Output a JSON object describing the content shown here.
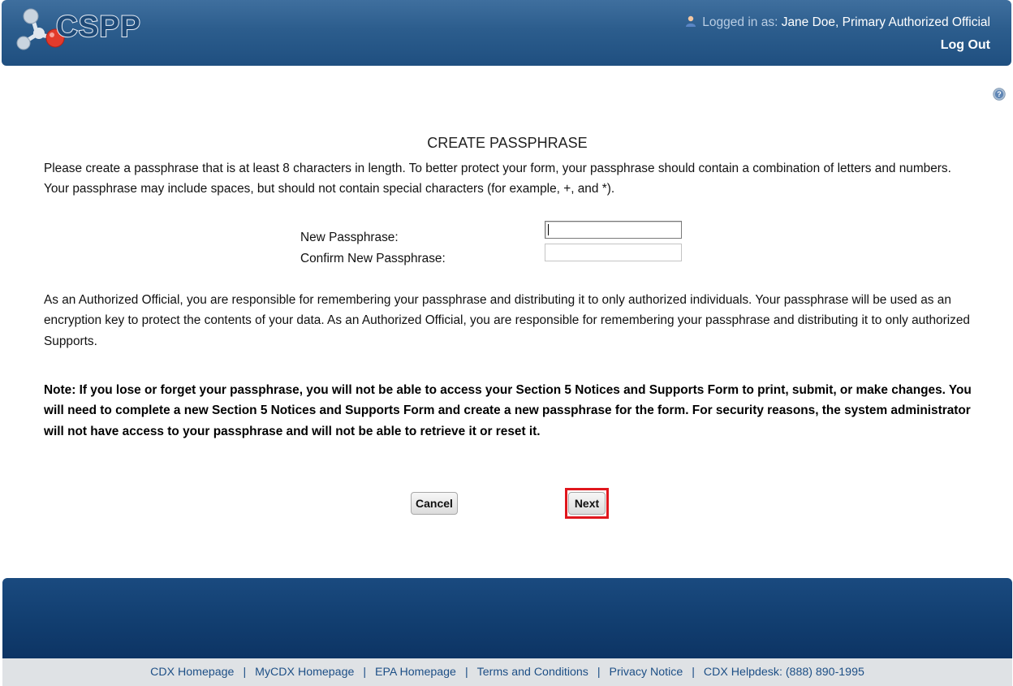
{
  "header": {
    "logo_text": "CSPP",
    "logged_in_prefix": "Logged in as:",
    "user_name": "Jane Doe, Primary Authorized Official",
    "logout_label": "Log Out"
  },
  "page": {
    "title": "CREATE PASSPHRASE",
    "intro": "Please create a passphrase that is at least 8 characters in length. To better protect your form, your passphrase should contain a combination of letters and numbers. Your passphrase may include spaces, but should not contain special characters (for example, +, and *).",
    "fields": {
      "new_label": "New Passphrase:",
      "new_value": "",
      "confirm_label": "Confirm New Passphrase:",
      "confirm_value": ""
    },
    "responsibility": "As an Authorized Official, you are responsible for remembering your passphrase and distributing it to only authorized individuals. Your passphrase will be used as an encryption key to protect the contents of your data. As an Authorized Official, you are responsible for remembering your passphrase and distributing it to only authorized Supports.",
    "note": "Note: If you lose or forget your passphrase, you will not be able to access your Section 5 Notices and Supports Form to print, submit, or make changes. You will need to complete a new Section 5 Notices and Supports Form and create a new passphrase for the form. For security reasons, the system administrator will not have access to your passphrase and will not be able to retrieve it or reset it.",
    "buttons": {
      "cancel": "Cancel",
      "next": "Next"
    }
  },
  "footer": {
    "links": [
      "CDX Homepage",
      "MyCDX Homepage",
      "EPA Homepage",
      "Terms and Conditions",
      "Privacy Notice",
      "CDX Helpdesk: (888) 890-1995"
    ],
    "separator": "|"
  },
  "colors": {
    "header_blue": "#2c5d8d",
    "footer_blue": "#123f71",
    "link_blue": "#1d4f86",
    "highlight_red": "#e0171d"
  }
}
